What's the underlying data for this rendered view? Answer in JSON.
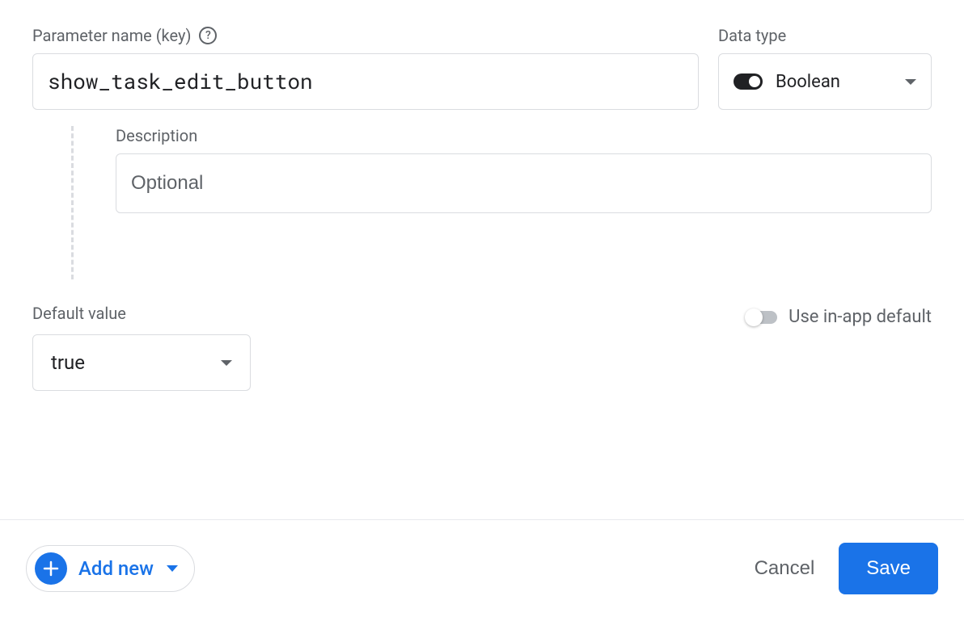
{
  "parameter": {
    "name_label": "Parameter name (key)",
    "name_value": "show_task_edit_button",
    "data_type_label": "Data type",
    "data_type_value": "Boolean",
    "description_label": "Description",
    "description_placeholder": "Optional",
    "description_value": "",
    "default_value_label": "Default value",
    "default_value": "true",
    "use_in_app_default_label": "Use in-app default",
    "use_in_app_default": false
  },
  "footer": {
    "add_new_label": "Add new",
    "cancel_label": "Cancel",
    "save_label": "Save"
  }
}
